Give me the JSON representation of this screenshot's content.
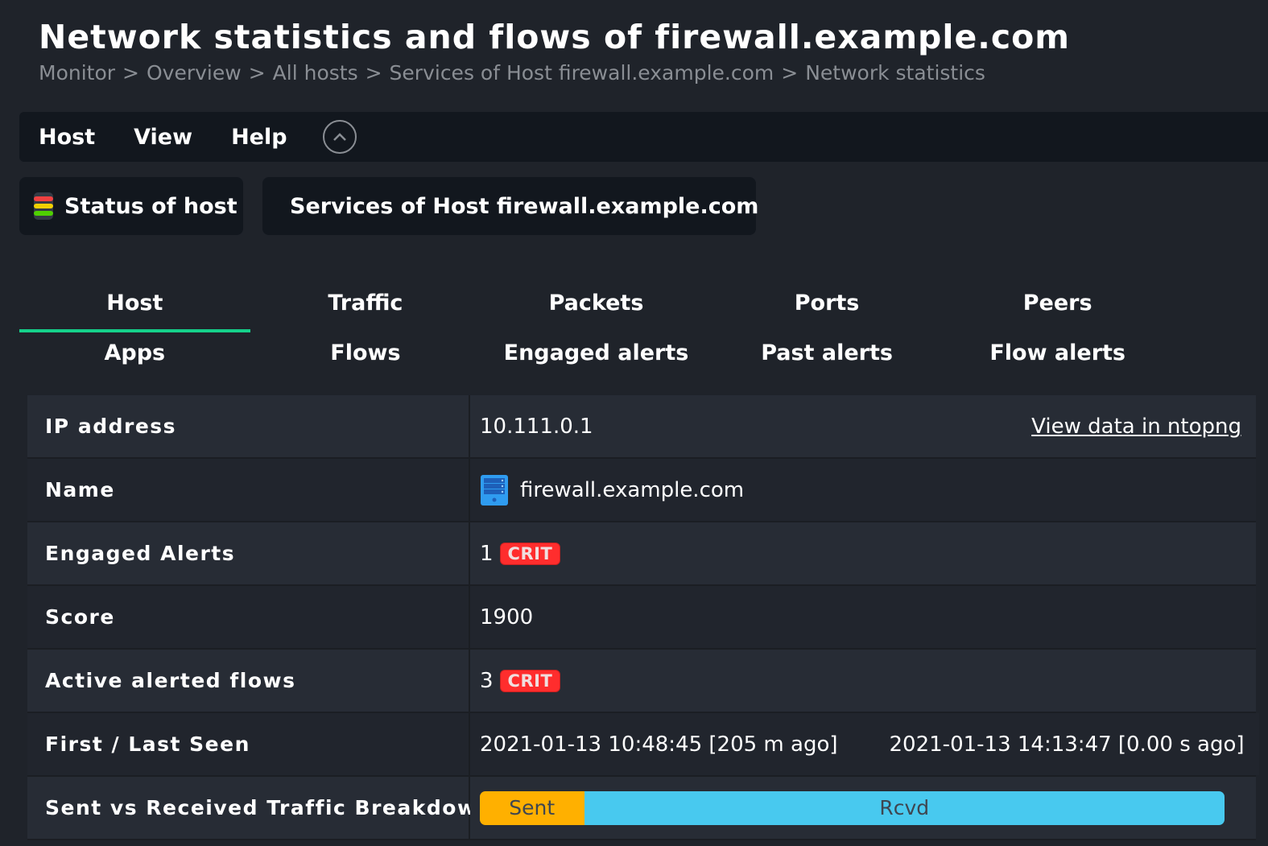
{
  "page": {
    "title": "Network statistics and flows of firewall.example.com",
    "breadcrumb": [
      "Monitor",
      "Overview",
      "All hosts",
      "Services of Host firewall.example.com",
      "Network statistics"
    ],
    "breadcrumb_separator": ">"
  },
  "menubar": {
    "items": [
      "Host",
      "View",
      "Help"
    ],
    "collapse_icon": "chevron-up-circle-icon"
  },
  "shortcuts": {
    "status_of_host": "Status of host",
    "services_of_host": "Services of Host firewall.example.com"
  },
  "tabs": [
    {
      "label": "Host",
      "active": true
    },
    {
      "label": "Traffic",
      "active": false
    },
    {
      "label": "Packets",
      "active": false
    },
    {
      "label": "Ports",
      "active": false
    },
    {
      "label": "Peers",
      "active": false
    },
    {
      "label": "Apps",
      "active": false
    },
    {
      "label": "Flows",
      "active": false
    },
    {
      "label": "Engaged alerts",
      "active": false
    },
    {
      "label": "Past alerts",
      "active": false
    },
    {
      "label": "Flow alerts",
      "active": false
    }
  ],
  "details": {
    "ip_address": {
      "label": "IP address",
      "value": "10.111.0.1",
      "link": "View data in ntopng"
    },
    "name": {
      "label": "Name",
      "value": "firewall.example.com",
      "icon": "server-icon"
    },
    "engaged_alerts": {
      "label": "Engaged Alerts",
      "count": "1",
      "badge": "CRIT"
    },
    "score": {
      "label": "Score",
      "value": "1900"
    },
    "active_alerted_flows": {
      "label": "Active alerted flows",
      "count": "3",
      "badge": "CRIT"
    },
    "first_last_seen": {
      "label": "First / Last Seen",
      "first": "2021-01-13 10:48:45 [205 m ago]",
      "last": "2021-01-13 14:13:47 [0.00 s ago]"
    },
    "traffic_breakdown": {
      "label": "Sent vs Received Traffic Breakdown",
      "sent_label": "Sent",
      "sent_percent": 14,
      "rcvd_label": "Rcvd",
      "rcvd_percent": 86
    }
  },
  "colors": {
    "accent_tab": "#15d08a",
    "crit": "#ff2d2d",
    "sent": "#ffb000",
    "rcvd": "#48c9ef",
    "link_icon": "#2a8fe6"
  }
}
